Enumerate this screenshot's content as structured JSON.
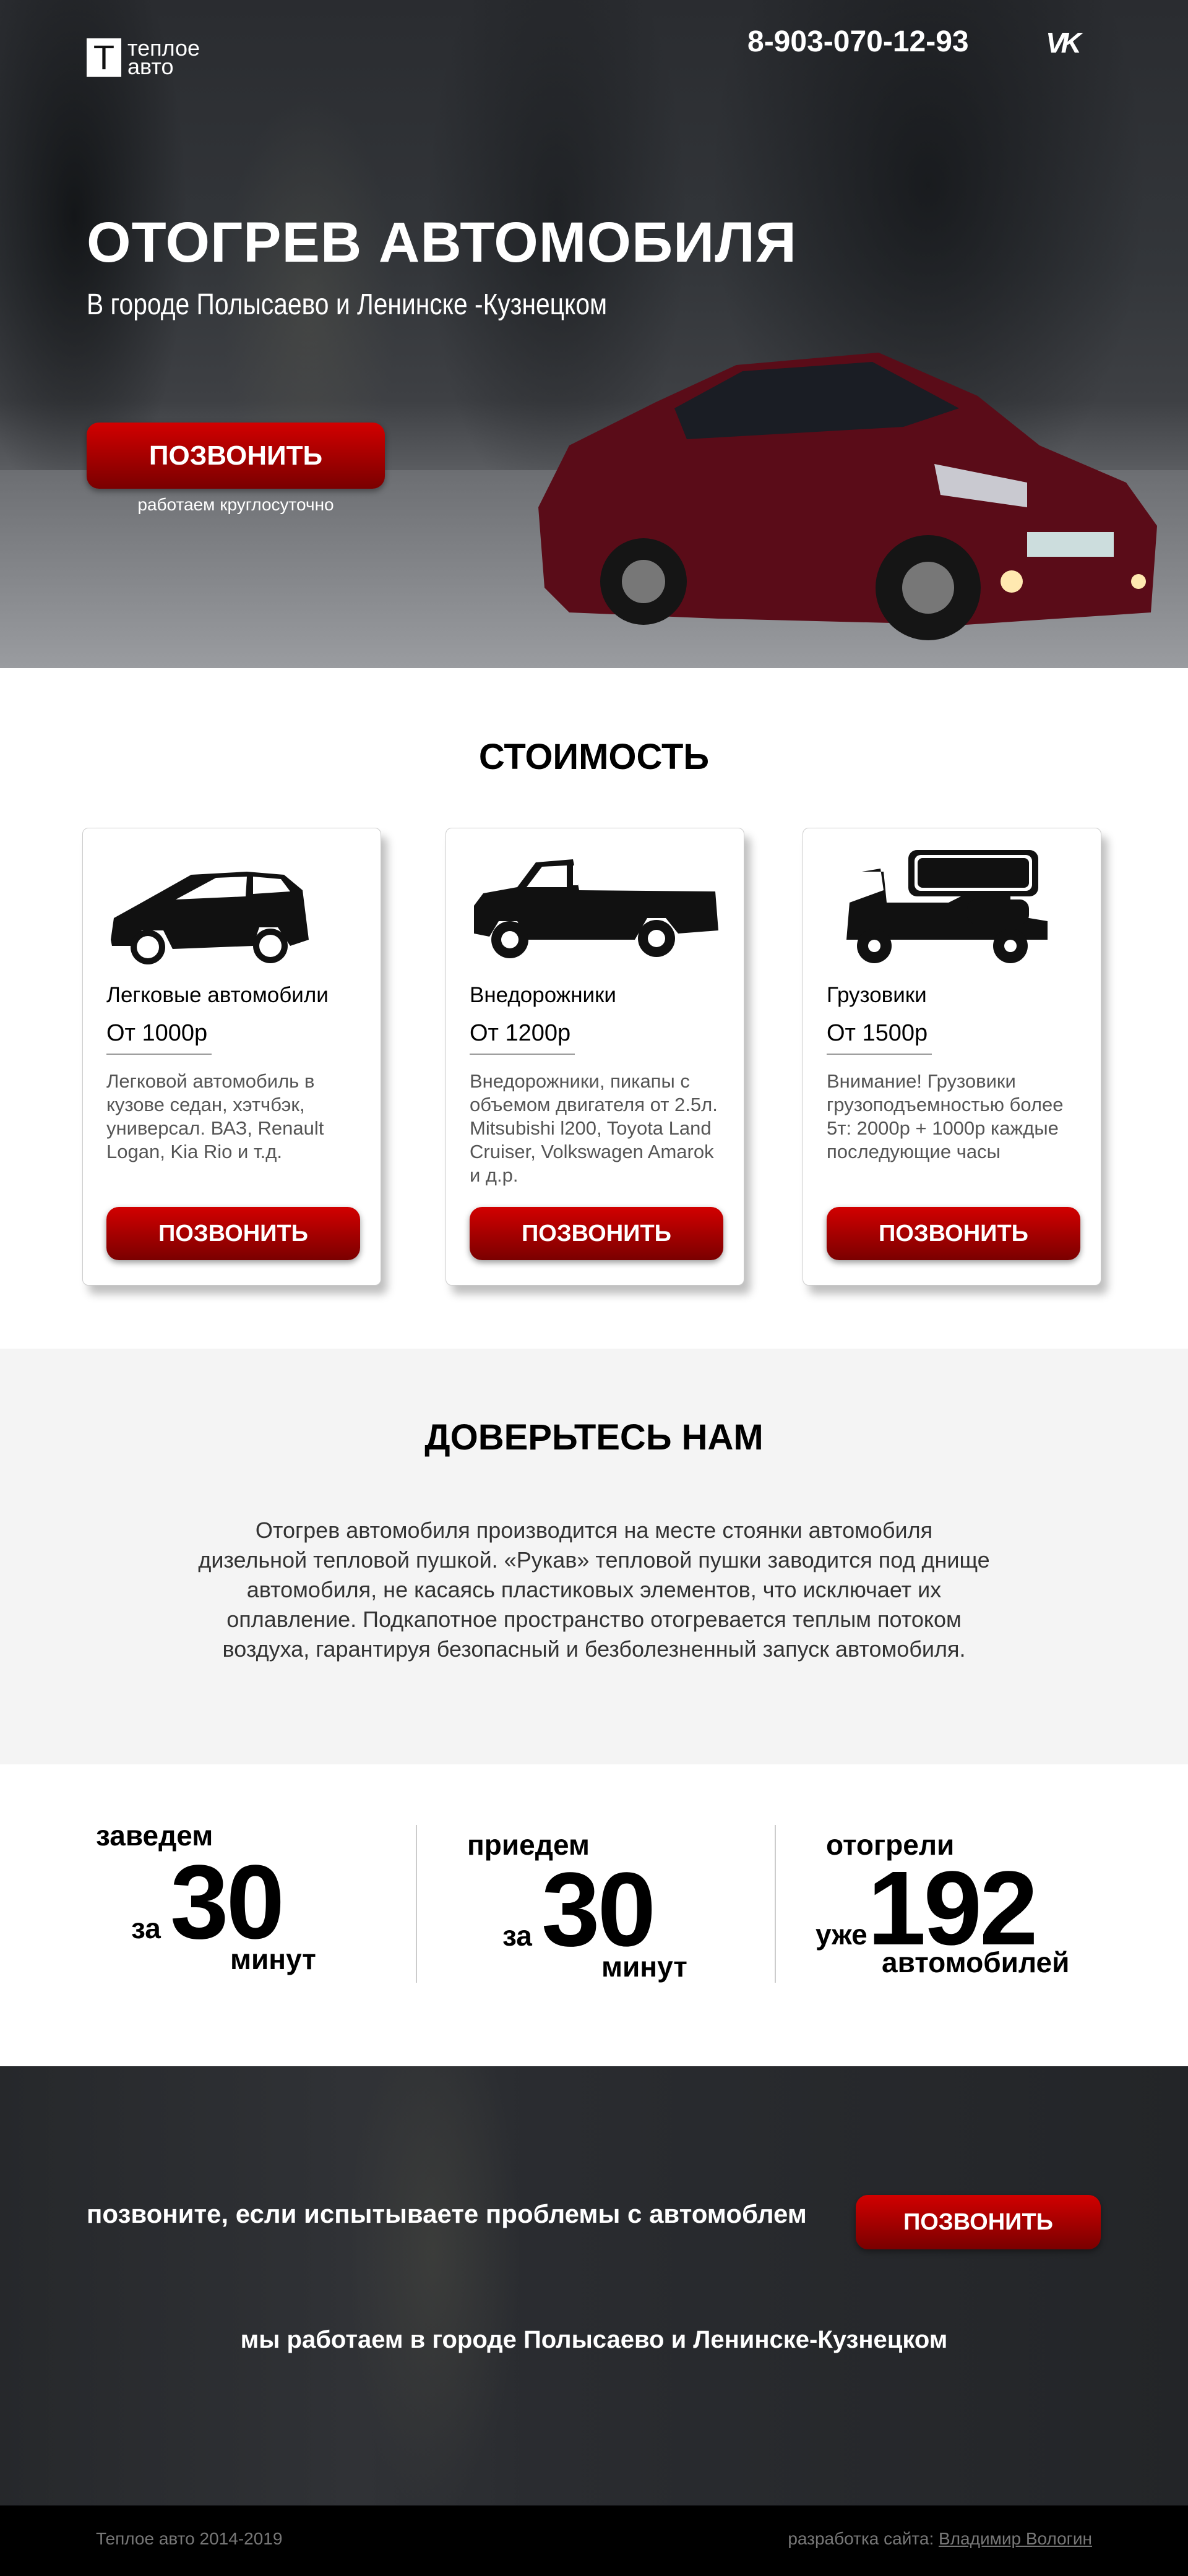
{
  "header": {
    "logo_letter": "Т",
    "logo_line1": "теплое",
    "logo_line2": "авто",
    "phone": "8-903-070-12-93",
    "vk_icon": "vk-icon",
    "vk_label": "VK"
  },
  "hero": {
    "title": "ОТОГРЕВ АВТОМОБИЛЯ",
    "subtitle": "В городе Полысаево и Ленинске -Кузнецком",
    "button": "ПОЗВОНИТЬ",
    "note": "работаем круглосуточно"
  },
  "pricing": {
    "title": "СТОИМОСТЬ",
    "cards": [
      {
        "icon": "hatchback-car-icon",
        "name": "Легковые автомобили",
        "price": "От 1000р",
        "desc": "Легковой автомобиль в кузове седан, хэтчбэк, универсал. ВАЗ, Renault Logan, Kia Rio и т.д.",
        "button": "ПОЗВОНИТЬ"
      },
      {
        "icon": "pickup-truck-icon",
        "name": "Внедорожники",
        "price": "От 1200р",
        "desc": "Внедорожники, пикапы с объемом двигателя от 2.5л. Mitsubishi l200, Toyota Land Cruiser, Volkswagen Amarok и д.р.",
        "button": "ПОЗВОНИТЬ"
      },
      {
        "icon": "tanker-truck-icon",
        "name": "Грузовики",
        "price": "От 1500р",
        "desc": "Внимание! Грузовики грузоподъемностью более 5т: 2000р + 1000р каждые последующие часы",
        "button": "ПОЗВОНИТЬ"
      }
    ]
  },
  "trust": {
    "title": "ДОВЕРЬТЕСЬ НАМ",
    "text": "Отогрев автомобиля производится на месте стоянки автомобиля дизельной тепловой пушкой. «Рукав» тепловой пушки заводится под днище автомобиля, не касаясь пластиковых элементов, что исключает их оплавление. Подкапотное пространство отогревается теплым потоком воздуха, гарантируя безопасный и безболезненный запуск автомобиля."
  },
  "stats": [
    {
      "top": "заведем",
      "pre": "за",
      "num": "30",
      "bottom": "минут"
    },
    {
      "top": "приедем",
      "pre": "за",
      "num": "30",
      "bottom": "минут"
    },
    {
      "top": "отогрели",
      "pre": "уже",
      "num": "192",
      "bottom": "автомобилей"
    }
  ],
  "cta": {
    "text": "позвоните, если испытываете проблемы с автомоблем",
    "button": "ПОЗВОНИТЬ",
    "note": "мы работаем в городе Полысаево и Ленинске-Кузнецком"
  },
  "footer": {
    "copyright": "Теплое авто 2014-2019",
    "dev_label": "разработка сайта:",
    "dev_name": "Владимир Вологин"
  },
  "colors": {
    "accent_top": "#d20000",
    "accent_bottom": "#7a0000",
    "gray_bg": "#f4f4f4",
    "footer_bg": "#000000"
  }
}
